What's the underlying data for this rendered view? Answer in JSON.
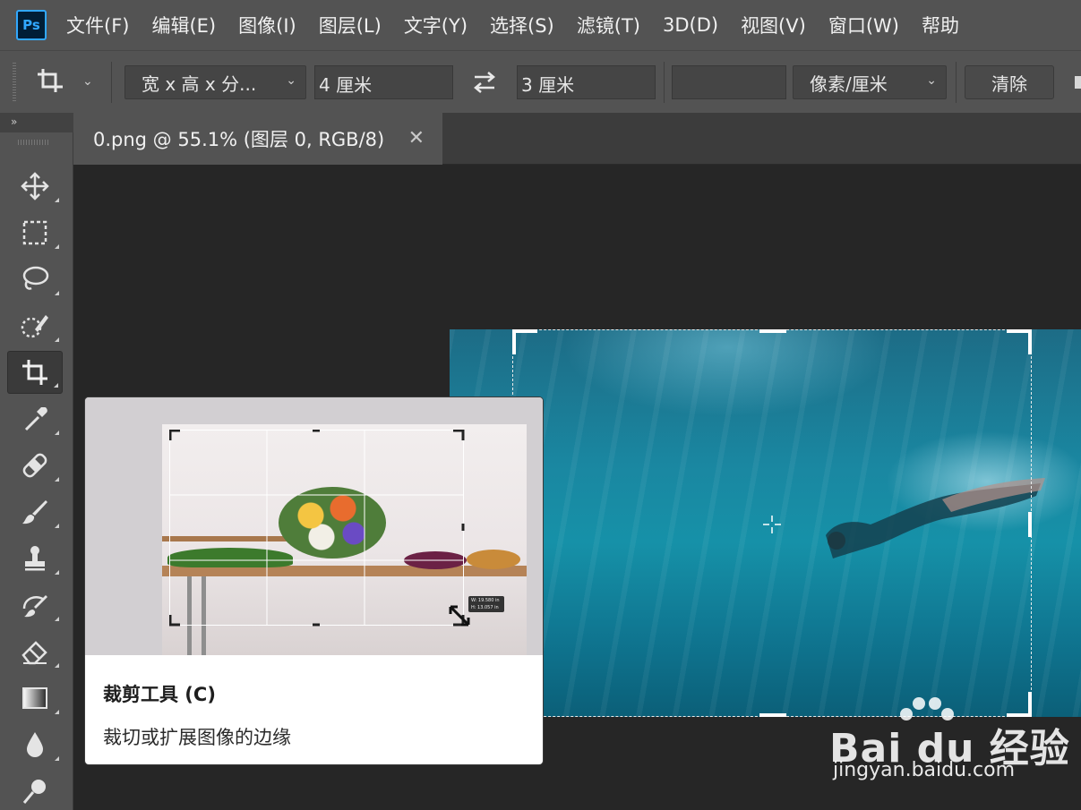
{
  "app": {
    "logo_text": "Ps",
    "menu": [
      "文件(F)",
      "编辑(E)",
      "图像(I)",
      "图层(L)",
      "文字(Y)",
      "选择(S)",
      "滤镜(T)",
      "3D(D)",
      "视图(V)",
      "窗口(W)",
      "帮助"
    ]
  },
  "options_bar": {
    "preset_label": "宽 x 高 x 分...",
    "width_value": "4 厘米",
    "height_value": "3 厘米",
    "resolution_value": "",
    "unit_label": "像素/厘米",
    "clear_label": "清除"
  },
  "toolbar": {
    "collapse_label": "»",
    "tools": [
      "move-tool",
      "marquee-tool",
      "lasso-tool",
      "quick-selection-tool",
      "crop-tool",
      "eyedropper-tool",
      "healing-brush-tool",
      "brush-tool",
      "clone-stamp-tool",
      "history-brush-tool",
      "eraser-tool",
      "gradient-tool",
      "blur-tool",
      "dodge-tool"
    ],
    "active_tool": "crop-tool"
  },
  "document": {
    "tab_label": "0.png @ 55.1% (图层 0, RGB/8)"
  },
  "tooltip": {
    "title": "裁剪工具 (C)",
    "description": "裁切或扩展图像的边缘",
    "preview_readout": [
      "W: 19.580 in",
      "H: 13.057 in"
    ]
  },
  "watermark": {
    "logo": "Bai du 经验",
    "url": "jingyan.baidu.com"
  },
  "colors": {
    "ui_panel": "#535353",
    "canvas_bg": "#262626",
    "ps_blue": "#31a8ff"
  }
}
